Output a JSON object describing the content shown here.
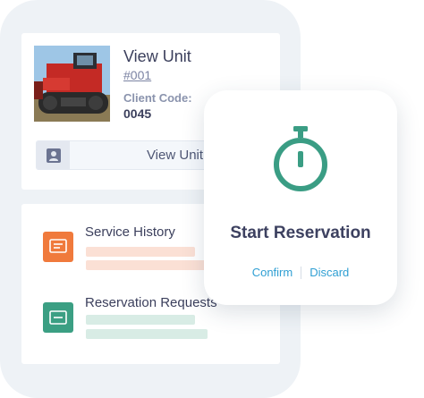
{
  "unit": {
    "title": "View Unit",
    "id": "#001",
    "client_label": "Client Code:",
    "client_code": "0045",
    "view_button": "View Unit"
  },
  "list": {
    "items": [
      {
        "title": "Service History",
        "icon": "receipt-icon",
        "color": "#f07a3c",
        "bar_color": "#fbe0d5"
      },
      {
        "title": "Reservation Requests",
        "icon": "card-icon",
        "color": "#3b9f83",
        "bar_color": "#d8ece5"
      }
    ]
  },
  "reservation": {
    "title": "Start Reservation",
    "confirm": "Confirm",
    "discard": "Discard",
    "icon": "stopwatch-icon",
    "icon_color": "#3a9d84"
  }
}
